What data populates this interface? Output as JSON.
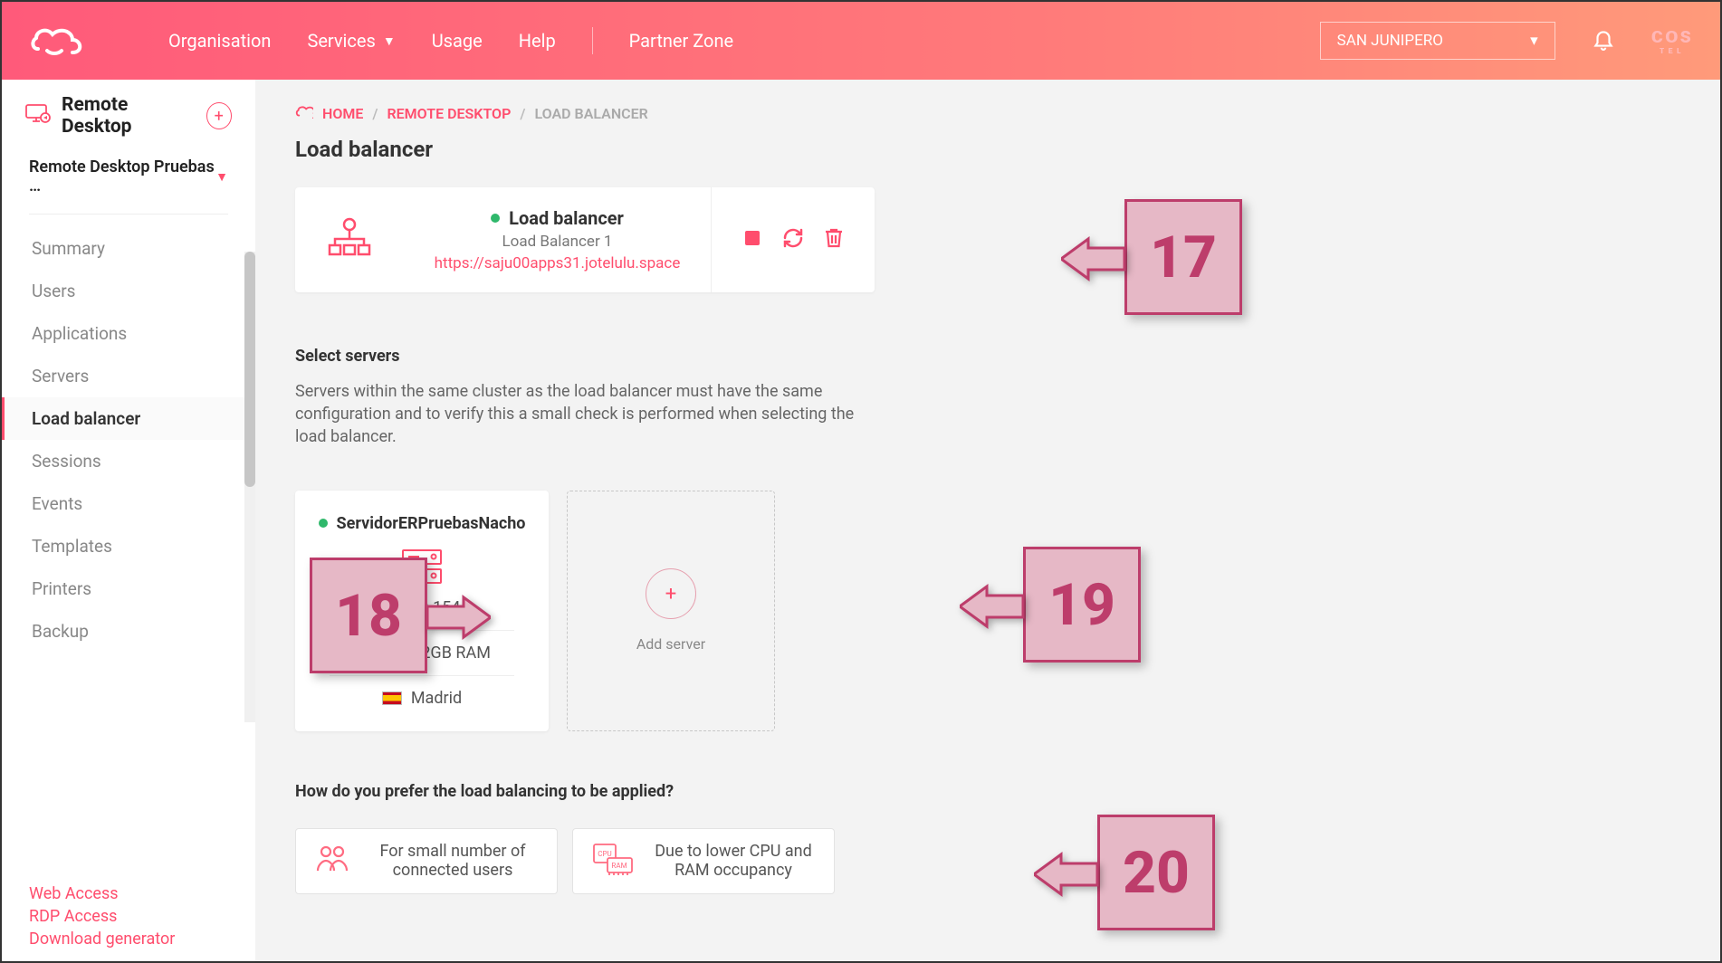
{
  "header": {
    "nav": {
      "organisation": "Organisation",
      "services": "Services",
      "usage": "Usage",
      "help": "Help",
      "partner": "Partner Zone"
    },
    "org_selected": "SAN JUNIPERO"
  },
  "sidebar": {
    "title": "Remote Desktop",
    "subtitle": "Remote Desktop Pruebas …",
    "items": [
      "Summary",
      "Users",
      "Applications",
      "Servers",
      "Load balancer",
      "Sessions",
      "Events",
      "Templates",
      "Printers",
      "Backup"
    ],
    "active_index": 4,
    "footer": [
      "Web Access",
      "RDP Access",
      "Download generator"
    ]
  },
  "crumbs": {
    "home": "HOME",
    "c1": "REMOTE DESKTOP",
    "c2": "LOAD BALANCER"
  },
  "page": {
    "title": "Load balancer"
  },
  "lb": {
    "name": "Load balancer",
    "subname": "Load Balancer 1",
    "url": "https://saju00apps31.jotelulu.space"
  },
  "select_servers": {
    "title": "Select servers",
    "help": "Servers within the same cluster as the load balancer must have the same configuration and to verify this a small check is performed when selecting the load balancer."
  },
  "server": {
    "name": "ServidorERPruebasNacho",
    "ip": "10.0.0.154",
    "spec": "2 Cores - 2GB RAM",
    "location": "Madrid"
  },
  "add_server_label": "Add server",
  "balancing": {
    "question": "How do you prefer the load balancing to be applied?",
    "opt1": "For small number of connected users",
    "opt2": "Due to lower CPU and RAM occupancy"
  },
  "callouts": {
    "c17": "17",
    "c18": "18",
    "c19": "19",
    "c20": "20"
  }
}
